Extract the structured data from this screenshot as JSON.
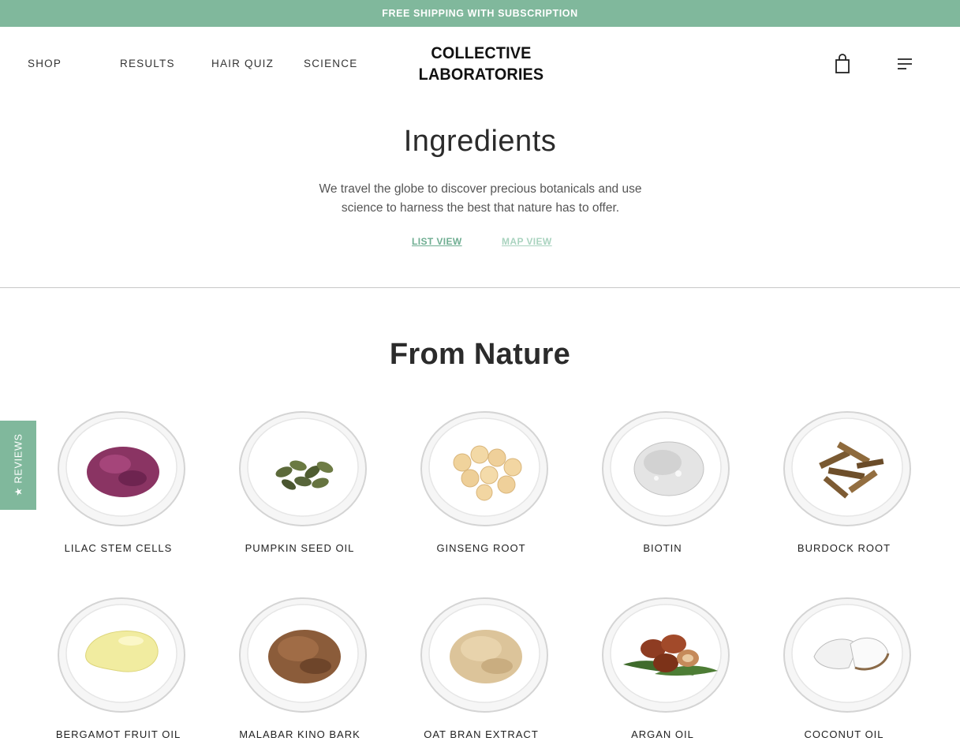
{
  "announcement": "FREE SHIPPING WITH SUBSCRIPTION",
  "nav": {
    "shop": "SHOP",
    "results": "RESULTS",
    "hair_quiz": "HAIR QUIZ",
    "science": "SCIENCE"
  },
  "logo": {
    "line1": "COLLECTIVE",
    "line2": "LABORATORIES"
  },
  "icons": {
    "cart": "shopping-bag-icon",
    "menu": "hamburger-menu-icon",
    "reviews_star": "star-icon"
  },
  "hero": {
    "title": "Ingredients",
    "subtitle_line1": "We travel the globe to discover precious botanicals and use",
    "subtitle_line2": "science to harness the best that nature has to offer.",
    "list_view": "LIST VIEW",
    "map_view": "MAP VIEW"
  },
  "section": {
    "title": "From Nature"
  },
  "ingredients": [
    {
      "name": "LILAC STEM CELLS",
      "visual": "purple-powder"
    },
    {
      "name": "PUMPKIN SEED OIL",
      "visual": "pumpkin-seeds"
    },
    {
      "name": "GINSENG ROOT",
      "visual": "ginseng-slices"
    },
    {
      "name": "BIOTIN",
      "visual": "clear-gel"
    },
    {
      "name": "BURDOCK ROOT",
      "visual": "dried-root-pieces"
    },
    {
      "name": "BERGAMOT FRUIT OIL",
      "visual": "yellow-oil"
    },
    {
      "name": "MALABAR KINO BARK",
      "visual": "brown-granules"
    },
    {
      "name": "OAT BRAN EXTRACT",
      "visual": "beige-powder"
    },
    {
      "name": "ARGAN OIL",
      "visual": "argan-nuts"
    },
    {
      "name": "COCONUT OIL",
      "visual": "coconut-pieces"
    }
  ],
  "reviews_tab": {
    "label": "★ REVIEWS"
  },
  "colors": {
    "accent": "#80b89c",
    "list_view": "#6fae92",
    "map_view": "#a9d3bf",
    "text_dark": "#2b2b2b"
  }
}
